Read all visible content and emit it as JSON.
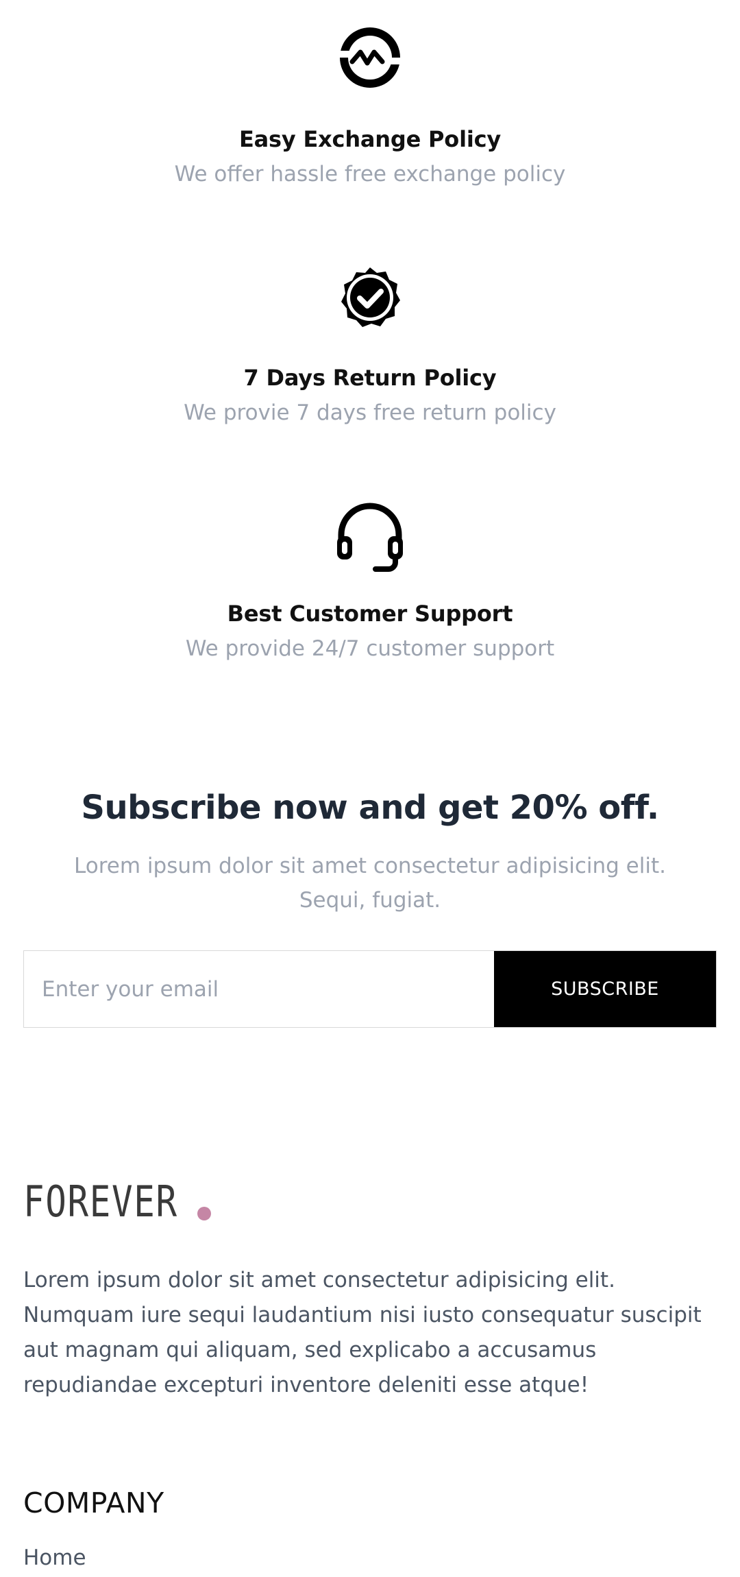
{
  "policies": [
    {
      "icon": "exchange-icon",
      "title": "Easy Exchange Policy",
      "description": "We offer hassle free exchange policy"
    },
    {
      "icon": "quality-badge-icon",
      "title": "7 Days Return Policy",
      "description": "We provie 7 days free return policy"
    },
    {
      "icon": "headset-icon",
      "title": "Best Customer Support",
      "description": "We provide 24/7 customer support"
    }
  ],
  "subscribe": {
    "title": "Subscribe now and get 20% off.",
    "text": "Lorem ipsum dolor sit amet consectetur adipisicing elit. Sequi, fugiat.",
    "email_placeholder": "Enter your email",
    "button_label": "SUBSCRIBE"
  },
  "footer": {
    "logo_text": "FOREVER",
    "logo_dot_color": "#c586a5",
    "description": "Lorem ipsum dolor sit amet consectetur adipisicing elit. Numquam iure sequi laudantium nisi iusto consequatur suscipit aut magnam qui aliquam, sed explicabo a accusamus repudiandae excepturi inventore deleniti esse atque!",
    "company_heading": "COMPANY",
    "company_links": [
      "Home"
    ]
  }
}
